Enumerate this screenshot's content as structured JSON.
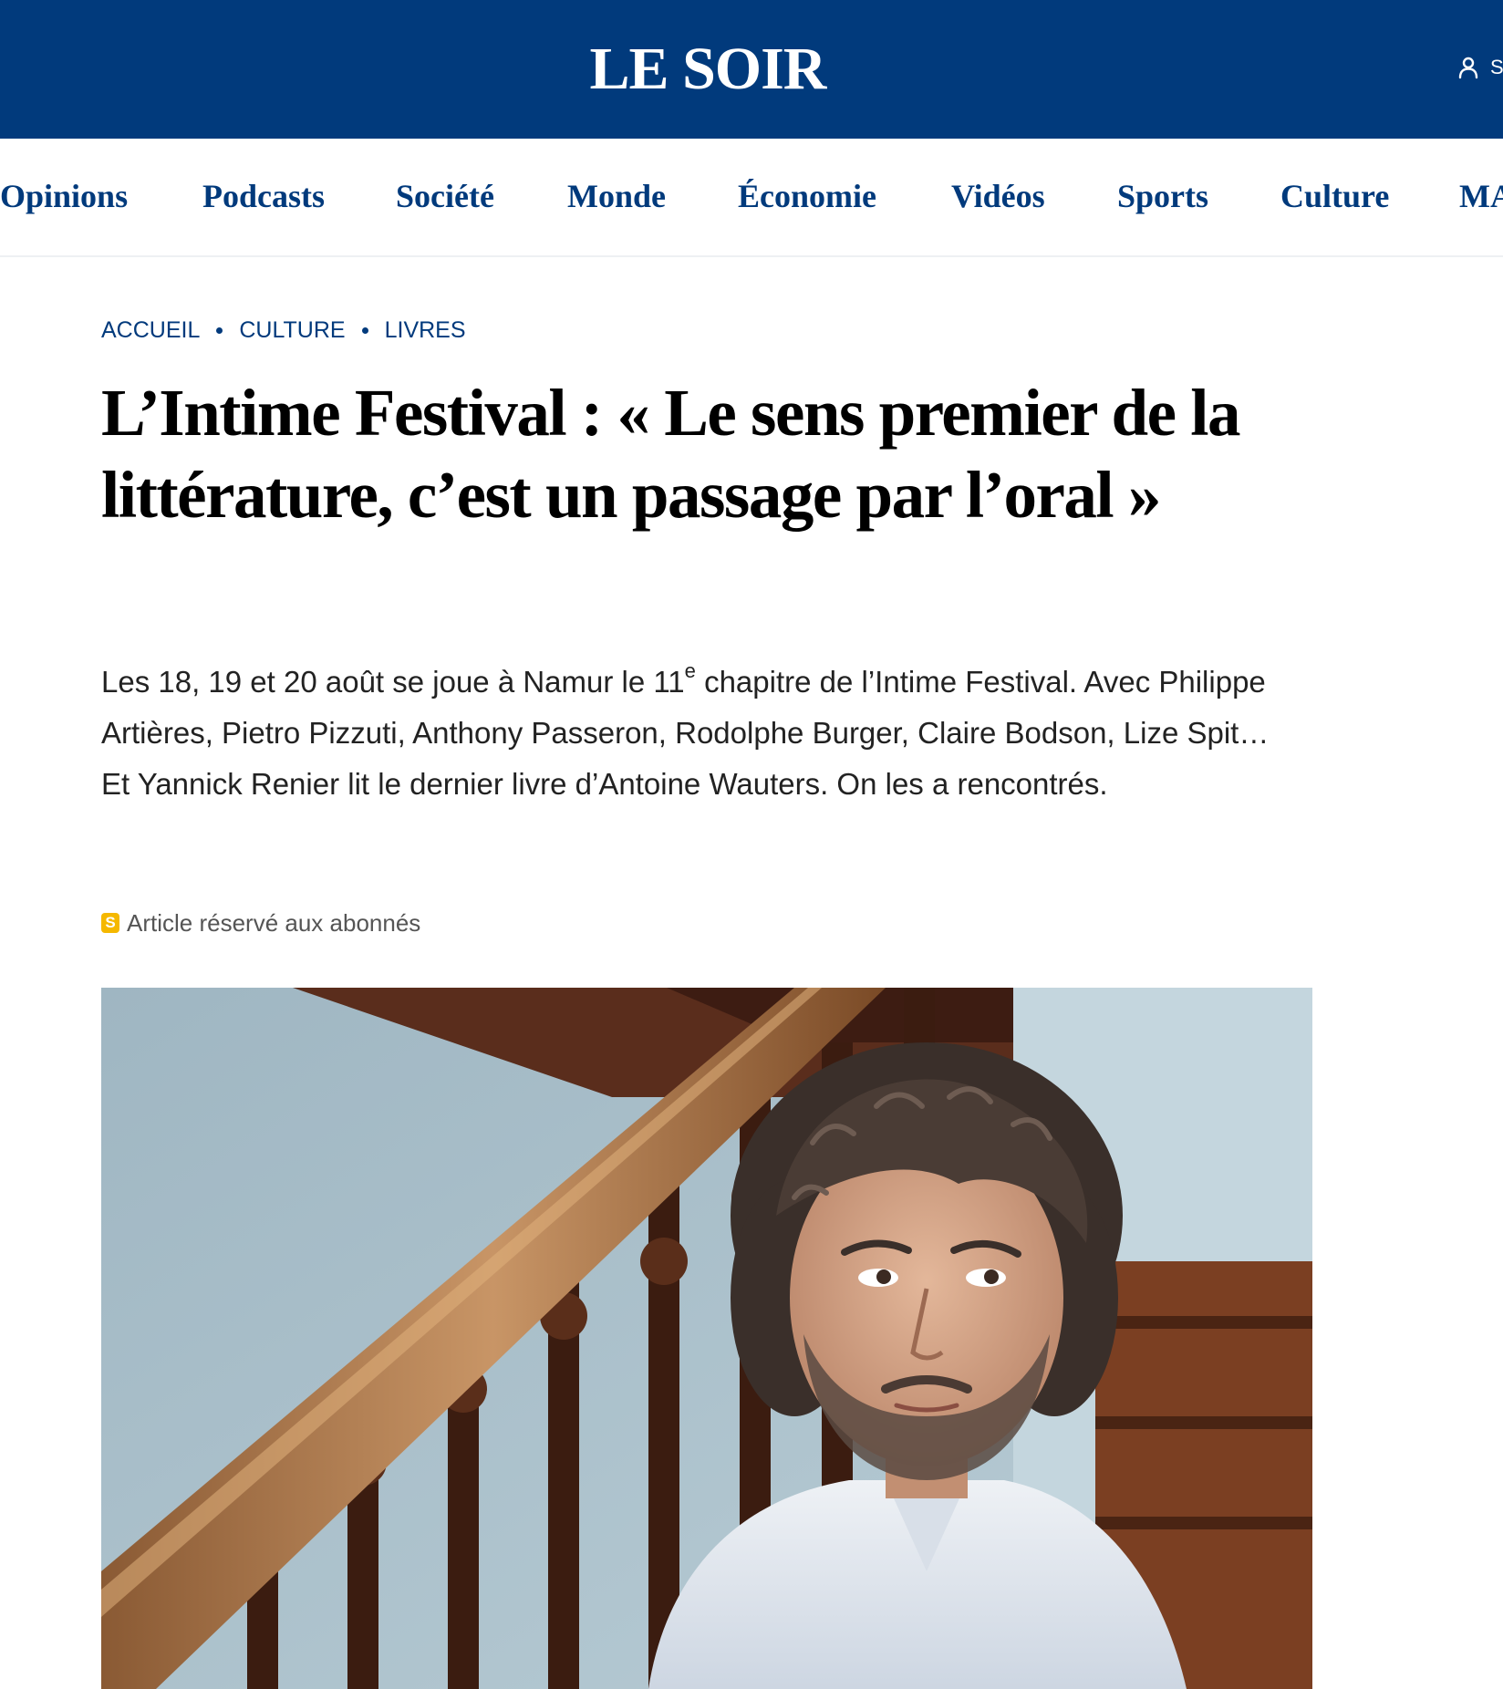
{
  "header": {
    "logo_text": "LE SOIR",
    "account_icon": "user-icon",
    "account_label": "S",
    "background_color": "#013a7c"
  },
  "nav": {
    "items": [
      {
        "label": "Opinions"
      },
      {
        "label": "Podcasts"
      },
      {
        "label": "Société"
      },
      {
        "label": "Monde"
      },
      {
        "label": "Économie"
      },
      {
        "label": "Vidéos"
      },
      {
        "label": "Sports"
      },
      {
        "label": "Culture"
      },
      {
        "label": "MA"
      }
    ],
    "text_color": "#013a7c"
  },
  "breadcrumb": {
    "items": [
      {
        "label": "ACCUEIL"
      },
      {
        "label": "CULTURE"
      },
      {
        "label": "LIVRES"
      }
    ]
  },
  "article": {
    "title": "L’Intime Festival : « Le sens premier de la littérature, c’est un passage par l’oral »",
    "lead": {
      "part1": "Les 18, 19 et 20 août se joue à Namur le 11",
      "superscript": "e",
      "part2": " chapitre de l’Intime Festival. Avec Philippe Artières, Pietro Pizzuti, Anthony Passeron, Rodolphe Burger, Claire Bodson, Lize Spit… Et Yannick Renier lit le dernier livre d’Antoine Wauters. On les a rencontrés."
    },
    "subscriber": {
      "badge": "S",
      "label": "Article réservé aux abonnés",
      "badge_color": "#f5b800"
    },
    "hero_image": {
      "subject": "portrait photo of a curly-haired man in a white shirt next to a wooden staircase banister"
    }
  }
}
